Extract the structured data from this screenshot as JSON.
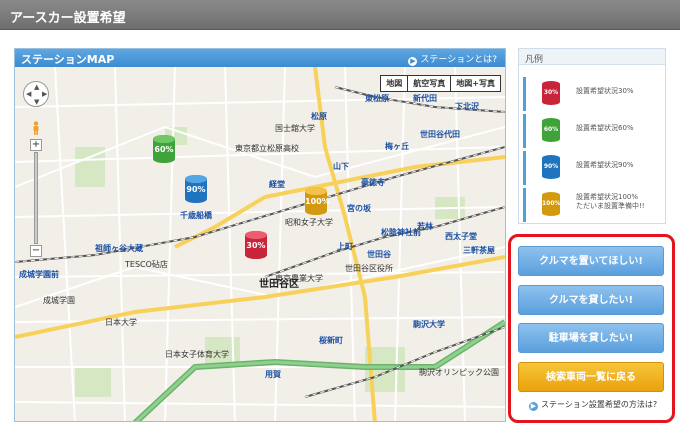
{
  "header": {
    "title": "アースカー設置希望"
  },
  "map_panel": {
    "title": "ステーションMAP",
    "help_link": "ステーションとは?",
    "map_types": [
      "地図",
      "航空写真",
      "地図+写真"
    ],
    "area_label": "世田谷区",
    "labels": [
      {
        "text": "下北沢",
        "cls": "stb"
      },
      {
        "text": "東松原",
        "cls": "st"
      },
      {
        "text": "新代田",
        "cls": "stb"
      },
      {
        "text": "梅ヶ丘",
        "cls": "stb"
      },
      {
        "text": "世田谷代田",
        "cls": "stb"
      },
      {
        "text": "山下",
        "cls": "stb"
      },
      {
        "text": "宮の坂",
        "cls": "stb"
      },
      {
        "text": "経堂",
        "cls": "stb"
      },
      {
        "text": "千歳船橋",
        "cls": "stb"
      },
      {
        "text": "上町",
        "cls": "stb"
      },
      {
        "text": "世田谷",
        "cls": "stb"
      },
      {
        "text": "松陰神社前",
        "cls": "stb"
      },
      {
        "text": "若林",
        "cls": "stb"
      },
      {
        "text": "西太子堂",
        "cls": "stb"
      },
      {
        "text": "三軒茶屋",
        "cls": "stb"
      },
      {
        "text": "駒沢大学",
        "cls": "stb"
      },
      {
        "text": "用賀",
        "cls": "stb"
      },
      {
        "text": "桜新町",
        "cls": "stb"
      },
      {
        "text": "成城学園前",
        "cls": "stb"
      },
      {
        "text": "祖師ヶ谷大蔵",
        "cls": "stb"
      },
      {
        "text": "豪徳寺",
        "cls": "stb"
      },
      {
        "text": "松原",
        "cls": "stb"
      },
      {
        "text": "成城学園",
        "cls": ""
      },
      {
        "text": "日本大学",
        "cls": ""
      },
      {
        "text": "東京農業大学",
        "cls": ""
      },
      {
        "text": "駒沢オリンピック公園",
        "cls": ""
      },
      {
        "text": "TESCO砧店",
        "cls": ""
      },
      {
        "text": "国士舘大学",
        "cls": ""
      },
      {
        "text": "昭和女子大学",
        "cls": ""
      },
      {
        "text": "東京都立松原高校",
        "cls": ""
      },
      {
        "text": "日本女子体育大学",
        "cls": ""
      },
      {
        "text": "世田谷区役所",
        "cls": ""
      }
    ],
    "markers": [
      {
        "value": "60%",
        "color": "#3fa33a",
        "top": "#6fc864"
      },
      {
        "value": "90%",
        "color": "#1f74c0",
        "top": "#55a6e6"
      },
      {
        "value": "100%",
        "color": "#d39a10",
        "top": "#f4c24a"
      },
      {
        "value": "30%",
        "color": "#c9253a",
        "top": "#ee5c70"
      }
    ]
  },
  "legend": {
    "title": "凡例",
    "items": [
      {
        "icon_value": "30%",
        "color": "#c9253a",
        "label": "設置希望状況30%"
      },
      {
        "icon_value": "60%",
        "color": "#3fa33a",
        "label": "設置希望状況60%"
      },
      {
        "icon_value": "90%",
        "color": "#1f74c0",
        "label": "設置希望状況90%"
      },
      {
        "icon_value": "100%",
        "color": "#d39a10",
        "label": "設置希望状況100%",
        "label2": "ただいま設置準備中!!"
      }
    ]
  },
  "actions": {
    "buttons": [
      {
        "label": "クルマを置いてほしい!",
        "style": "blue"
      },
      {
        "label": "クルマを貸したい!",
        "style": "blue"
      },
      {
        "label": "駐車場を貸したい!",
        "style": "blue"
      },
      {
        "label": "検索車両一覧に戻る",
        "style": "orange"
      }
    ],
    "howto_link": "ステーション設置希望の方法は?"
  },
  "colors": {
    "highlight_border": "#e4141c",
    "accent": "#5a9fdd"
  }
}
